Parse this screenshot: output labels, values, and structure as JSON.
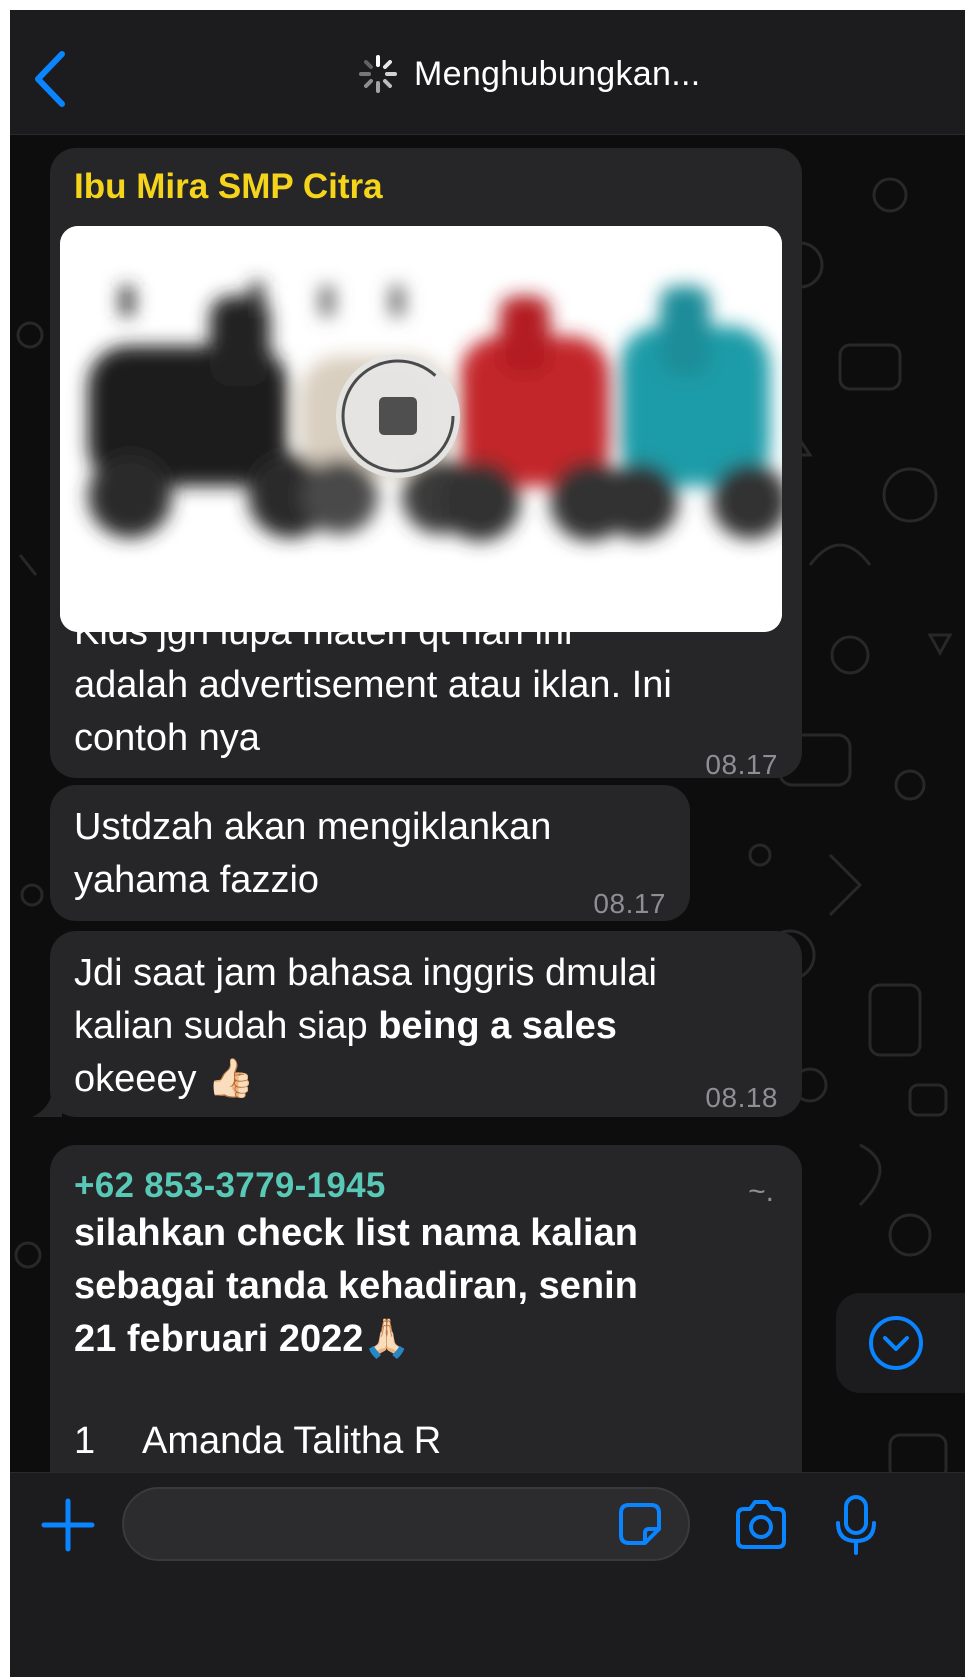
{
  "header": {
    "status": "Menghubungkan..."
  },
  "messages": [
    {
      "sender": "Ibu Mira SMP Citra",
      "line1": "Kids jgn lupa materi qt hari ini",
      "line2": "adalah advertisement atau iklan. Ini",
      "line3": "contoh nya",
      "time": "08.17"
    },
    {
      "line1": "Ustdzah akan mengiklankan",
      "line2": "yahama fazzio",
      "time": "08.17"
    },
    {
      "line1": "Jdi saat jam bahasa inggris dmulai",
      "line2_plain": "kalian sudah siap ",
      "line2_bold": "being a sales",
      "line3": "okeeey",
      "emoji": "👍🏻",
      "time": "08.18"
    },
    {
      "sender": "+62 853-3779-1945",
      "sender_suffix": "~.",
      "line1": "silahkan check list nama kalian",
      "line2": "sebagai tanda kehadiran, senin",
      "line3": "21 februari 2022",
      "emoji": "🙏🏻",
      "list": [
        {
          "num": "1",
          "name": "Amanda Talitha R"
        }
      ]
    }
  ],
  "composer": {
    "placeholder": ""
  },
  "icons": {
    "back": "chevron-left-icon",
    "status": "spinner-icon",
    "media_control": "stop-icon",
    "scroll": "chevron-down-circle-icon",
    "attach": "plus-icon",
    "sticker": "sticker-icon",
    "camera": "camera-icon",
    "mic": "microphone-icon"
  },
  "colors": {
    "accent": "#0a84ff",
    "sender_yellow": "#f5d51b",
    "sender_teal": "#59c9b7",
    "bubble": "#262628",
    "header": "#1c1c1e"
  }
}
